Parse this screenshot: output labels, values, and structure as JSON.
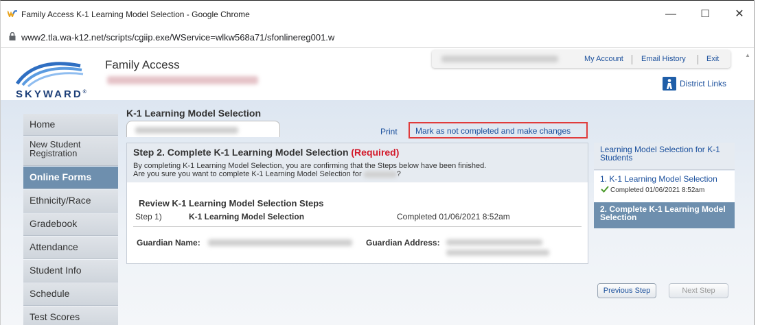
{
  "browser": {
    "window_title": "Family Access K-1 Learning Model Selection - Google Chrome",
    "url": "www2.tla.wa-k12.net/scripts/cgiip.exe/WService=wlkw568a71/sfonlinereg001.w",
    "minimize_glyph": "—",
    "maximize_glyph": "☐",
    "close_glyph": "✕"
  },
  "header": {
    "logo_text": "SKYWARD",
    "logo_mark": "®",
    "app_title": "Family Access",
    "links": {
      "my_account": "My Account",
      "email_history": "Email History",
      "exit": "Exit"
    },
    "district_links": "District Links"
  },
  "sidebar": {
    "items": [
      {
        "label": "Home"
      },
      {
        "label": "New Student Registration"
      },
      {
        "label": "Online Forms"
      },
      {
        "label": "Ethnicity/Race"
      },
      {
        "label": "Gradebook"
      },
      {
        "label": "Attendance"
      },
      {
        "label": "Student Info"
      },
      {
        "label": "Schedule"
      },
      {
        "label": "Test Scores"
      }
    ],
    "active_index": 2
  },
  "main": {
    "title": "K-1 Learning Model Selection",
    "print": "Print",
    "mark_not_completed": "Mark as not completed and make changes",
    "step_heading": "Step 2. Complete K-1 Learning Model Selection",
    "required": "(Required)",
    "confirm_line1": "By completing K-1 Learning Model Selection, you are confirming that the Steps below have been finished.",
    "confirm_line2": "Are you sure you want to complete K-1 Learning Model Selection for",
    "confirm_end": "?",
    "review_title": "Review K-1 Learning Model Selection Steps",
    "review_step_num": "Step 1)",
    "review_step_name": "K-1 Learning Model Selection",
    "review_step_completed": "Completed 01/06/2021 8:52am",
    "guardian_name_label": "Guardian Name:",
    "guardian_address_label": "Guardian Address:"
  },
  "steps_panel": {
    "heading": "Learning Model Selection for K-1 Students",
    "step1_label": "1. K-1 Learning Model Selection",
    "step1_completed": "Completed 01/06/2021 8:52am",
    "step2_label": "2. Complete K-1 Learning Model Selection",
    "previous_step": "Previous Step",
    "next_step": "Next Step"
  },
  "colors": {
    "link": "#1a4f9c",
    "required": "#d3192a",
    "highlight_box": "#e03c3c",
    "active_nav": "#6e8fae"
  }
}
